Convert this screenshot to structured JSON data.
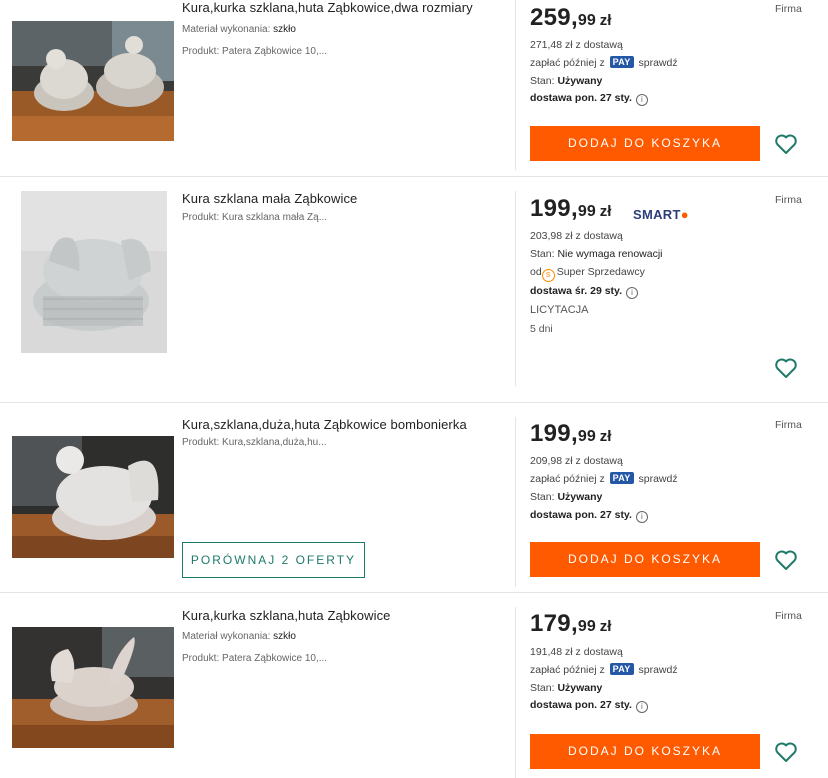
{
  "offers": [
    {
      "title": "Kura,kurka szklana,huta Ząbkowice,dwa rozmiary",
      "param1_label": "Materiał wykonania:",
      "param1_value": "szkło",
      "product": "Produkt: Patera Ząbkowice 10,...",
      "price_main": "259,",
      "price_cents": "99",
      "currency": "zł",
      "with_delivery": "271,48 zł z dostawą",
      "pay_prefix": "zapłać później z",
      "pay_badge": "PAY",
      "pay_suffix": "sprawdź",
      "condition_label": "Stan:",
      "condition_value": "Używany",
      "delivery": "dostawa pon. 27 sty.",
      "button": "DODAJ DO KOSZYKA",
      "seller_type": "Firma"
    },
    {
      "title": "Kura szklana mała Ząbkowice",
      "product": "Produkt: Kura szklana mała Zą...",
      "price_main": "199,",
      "price_cents": "99",
      "currency": "zł",
      "smart_label": "SMART",
      "with_delivery": "203,98 zł z dostawą",
      "condition_label": "Stan:",
      "condition_value": "Nie wymaga renowacji",
      "seller_prefix": "od",
      "seller_badge": "Super Sprzedawcy",
      "delivery": "dostawa śr. 29 sty.",
      "auction": "LICYTACJA",
      "time_left": "5 dni",
      "seller_type": "Firma"
    },
    {
      "title": "Kura,szklana,duża,huta Ząbkowice bombonierka",
      "product": "Produkt: Kura,szklana,duża,hu...",
      "compare_button": "PORÓWNAJ 2 OFERTY",
      "price_main": "199,",
      "price_cents": "99",
      "currency": "zł",
      "with_delivery": "209,98 zł z dostawą",
      "pay_prefix": "zapłać później z",
      "pay_badge": "PAY",
      "pay_suffix": "sprawdź",
      "condition_label": "Stan:",
      "condition_value": "Używany",
      "delivery": "dostawa pon. 27 sty.",
      "button": "DODAJ DO KOSZYKA",
      "seller_type": "Firma"
    },
    {
      "title": "Kura,kurka szklana,huta Ząbkowice",
      "param1_label": "Materiał wykonania:",
      "param1_value": "szkło",
      "product": "Produkt: Patera Ząbkowice 10,...",
      "price_main": "179,",
      "price_cents": "99",
      "currency": "zł",
      "with_delivery": "191,48 zł z dostawą",
      "pay_prefix": "zapłać później z",
      "pay_badge": "PAY",
      "pay_suffix": "sprawdź",
      "condition_label": "Stan:",
      "condition_value": "Używany",
      "delivery": "dostawa pon. 27 sty.",
      "button": "DODAJ DO KOSZYKA",
      "seller_type": "Firma"
    }
  ],
  "colors": {
    "accent": "#ff5a00",
    "heart": "#1f7a6a",
    "pay": "#2557a7"
  }
}
